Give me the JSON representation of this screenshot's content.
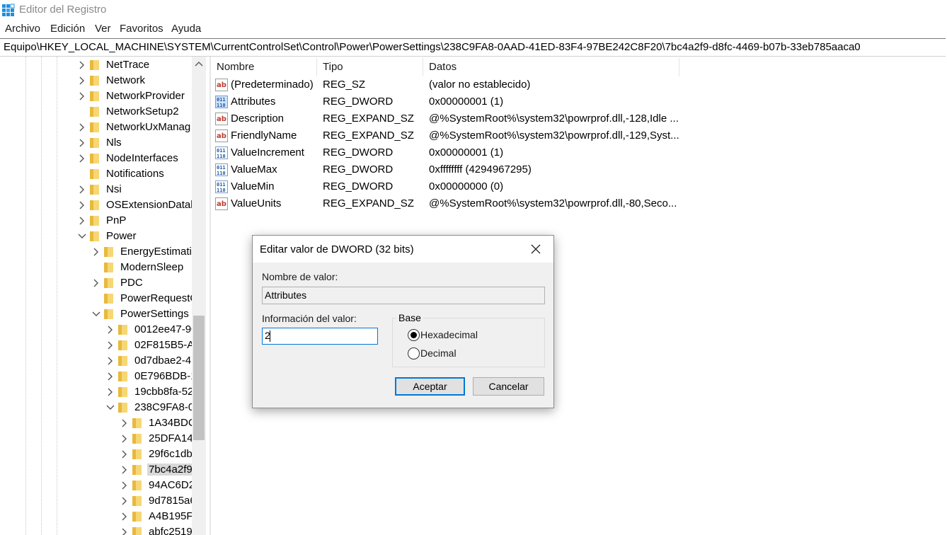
{
  "window": {
    "title": "Editor del Registro",
    "app_icon": "regedit-icon"
  },
  "menu": [
    "Archivo",
    "Edición",
    "Ver",
    "Favoritos",
    "Ayuda"
  ],
  "address": "Equipo\\HKEY_LOCAL_MACHINE\\SYSTEM\\CurrentControlSet\\Control\\Power\\PowerSettings\\238C9FA8-0AAD-41ED-83F4-97BE242C8F20\\7bc4a2f9-d8fc-4469-b07b-33eb785aaca0",
  "tree": [
    {
      "label": "NetTrace",
      "level": 0,
      "expander": "collapsed"
    },
    {
      "label": "Network",
      "level": 0,
      "expander": "collapsed"
    },
    {
      "label": "NetworkProvider",
      "level": 0,
      "expander": "collapsed"
    },
    {
      "label": "NetworkSetup2",
      "level": 0,
      "expander": "none"
    },
    {
      "label": "NetworkUxManag",
      "level": 0,
      "expander": "collapsed"
    },
    {
      "label": "Nls",
      "level": 0,
      "expander": "collapsed"
    },
    {
      "label": "NodeInterfaces",
      "level": 0,
      "expander": "collapsed"
    },
    {
      "label": "Notifications",
      "level": 0,
      "expander": "none"
    },
    {
      "label": "Nsi",
      "level": 0,
      "expander": "collapsed"
    },
    {
      "label": "OSExtensionDatab",
      "level": 0,
      "expander": "collapsed"
    },
    {
      "label": "PnP",
      "level": 0,
      "expander": "collapsed"
    },
    {
      "label": "Power",
      "level": 0,
      "expander": "expanded"
    },
    {
      "label": "EnergyEstimatio",
      "level": 1,
      "expander": "collapsed"
    },
    {
      "label": "ModernSleep",
      "level": 1,
      "expander": "none"
    },
    {
      "label": "PDC",
      "level": 1,
      "expander": "collapsed"
    },
    {
      "label": "PowerRequestO",
      "level": 1,
      "expander": "none"
    },
    {
      "label": "PowerSettings",
      "level": 1,
      "expander": "expanded"
    },
    {
      "label": "0012ee47-90",
      "level": 2,
      "expander": "collapsed"
    },
    {
      "label": "02F815B5-A",
      "level": 2,
      "expander": "collapsed"
    },
    {
      "label": "0d7dbae2-4",
      "level": 2,
      "expander": "collapsed"
    },
    {
      "label": "0E796BDB-1",
      "level": 2,
      "expander": "collapsed"
    },
    {
      "label": "19cbb8fa-52",
      "level": 2,
      "expander": "collapsed"
    },
    {
      "label": "238C9FA8-0",
      "level": 2,
      "expander": "expanded"
    },
    {
      "label": "1A34BDC",
      "level": 3,
      "expander": "collapsed"
    },
    {
      "label": "25DFA14",
      "level": 3,
      "expander": "collapsed"
    },
    {
      "label": "29f6c1db",
      "level": 3,
      "expander": "collapsed"
    },
    {
      "label": "7bc4a2f9",
      "level": 3,
      "expander": "collapsed",
      "selected": true
    },
    {
      "label": "94AC6D2",
      "level": 3,
      "expander": "collapsed"
    },
    {
      "label": "9d7815a6",
      "level": 3,
      "expander": "collapsed"
    },
    {
      "label": "A4B195F",
      "level": 3,
      "expander": "collapsed"
    },
    {
      "label": "abfc2519",
      "level": 3,
      "expander": "collapsed"
    }
  ],
  "columns": [
    "Nombre",
    "Tipo",
    "Datos"
  ],
  "values": [
    {
      "name": "(Predeterminado)",
      "type": "REG_SZ",
      "data": "(valor no establecido)",
      "icon": "string-value-icon"
    },
    {
      "name": "Attributes",
      "type": "REG_DWORD",
      "data": "0x00000001 (1)",
      "icon": "binary-value-icon",
      "selected": true
    },
    {
      "name": "Description",
      "type": "REG_EXPAND_SZ",
      "data": "@%SystemRoot%\\system32\\powrprof.dll,-128,Idle ...",
      "icon": "string-value-icon"
    },
    {
      "name": "FriendlyName",
      "type": "REG_EXPAND_SZ",
      "data": "@%SystemRoot%\\system32\\powrprof.dll,-129,Syst...",
      "icon": "string-value-icon"
    },
    {
      "name": "ValueIncrement",
      "type": "REG_DWORD",
      "data": "0x00000001 (1)",
      "icon": "binary-value-icon"
    },
    {
      "name": "ValueMax",
      "type": "REG_DWORD",
      "data": "0xffffffff (4294967295)",
      "icon": "binary-value-icon"
    },
    {
      "name": "ValueMin",
      "type": "REG_DWORD",
      "data": "0x00000000 (0)",
      "icon": "binary-value-icon"
    },
    {
      "name": "ValueUnits",
      "type": "REG_EXPAND_SZ",
      "data": "@%SystemRoot%\\system32\\powrprof.dll,-80,Seco...",
      "icon": "string-value-icon"
    }
  ],
  "dialog": {
    "title": "Editar valor de DWORD (32 bits)",
    "name_label": "Nombre de valor:",
    "name_value": "Attributes",
    "data_label": "Información del valor:",
    "data_value": "2",
    "base_label": "Base",
    "radio_hex": "Hexadecimal",
    "radio_dec": "Decimal",
    "base_selected": "Hexadecimal",
    "ok": "Aceptar",
    "cancel": "Cancelar"
  },
  "colors": {
    "accent": "#0078d7",
    "folder": "#e8b93b",
    "selection": "#d9d9d9"
  }
}
